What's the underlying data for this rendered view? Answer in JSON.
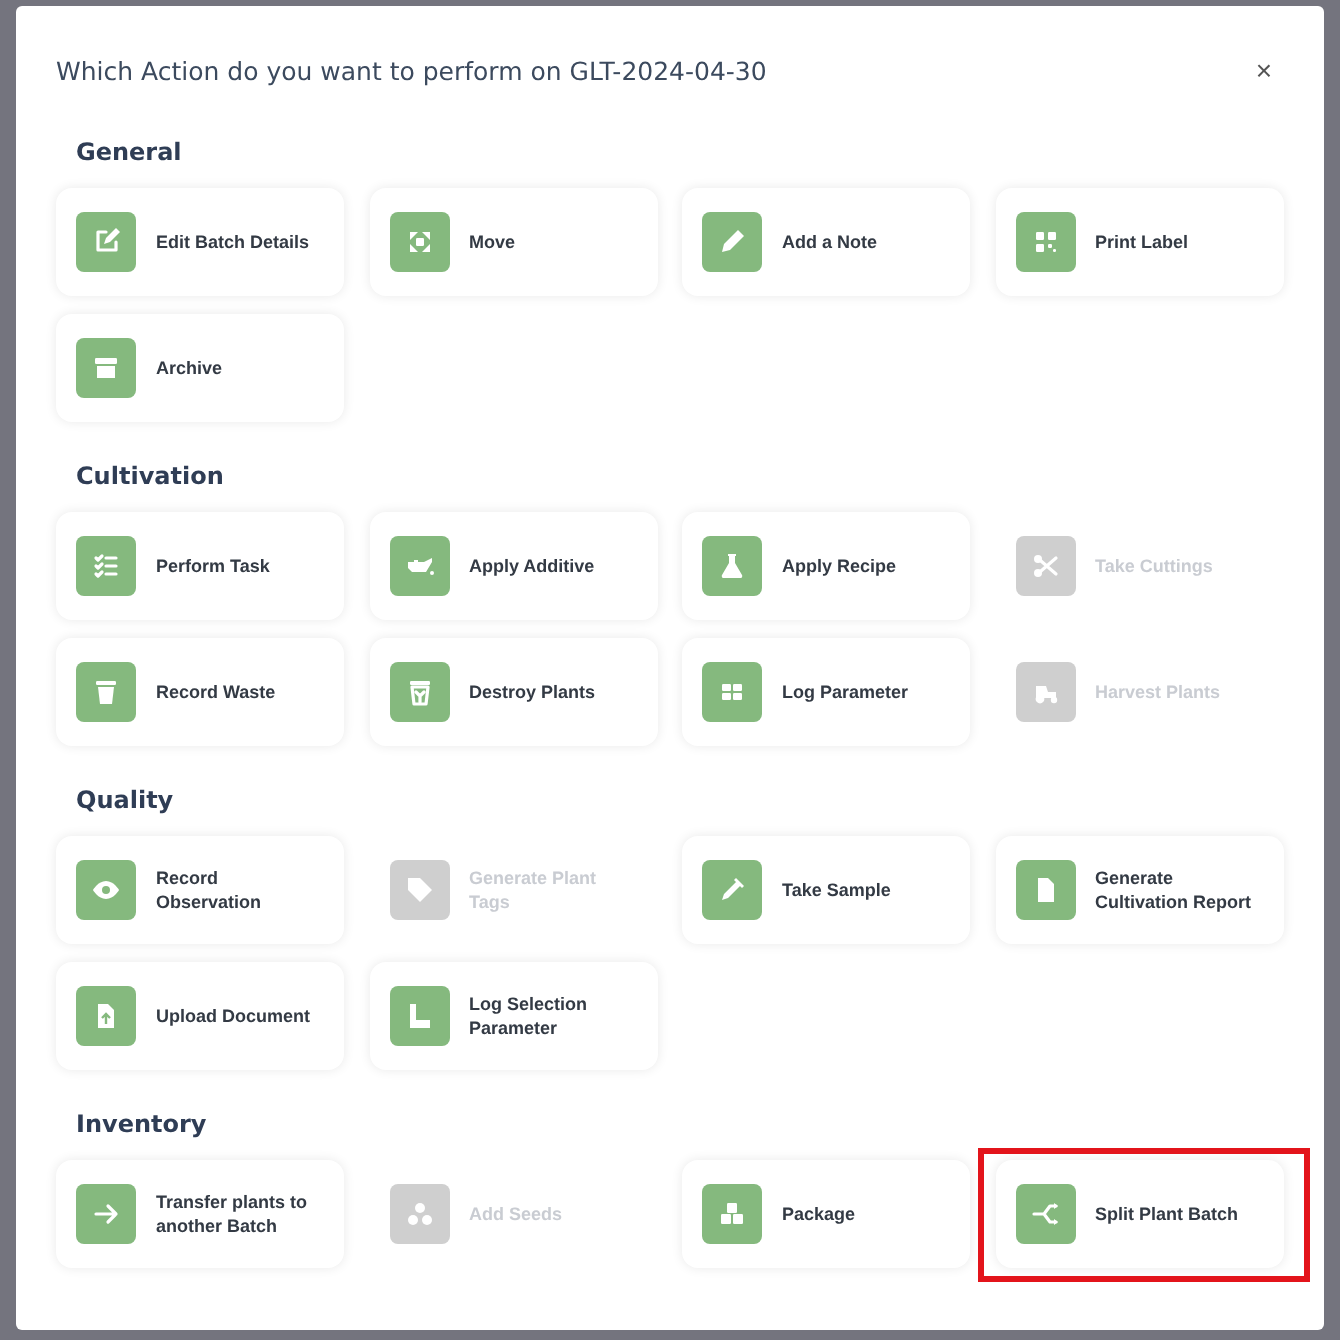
{
  "dialog": {
    "title": "Which Action do you want to perform on GLT-2024-04-30",
    "close": "×"
  },
  "sections": [
    {
      "title": "General",
      "items": [
        {
          "label": "Edit Batch Details",
          "disabled": false,
          "highlighted": false
        },
        {
          "label": "Move",
          "disabled": false,
          "highlighted": false
        },
        {
          "label": "Add a Note",
          "disabled": false,
          "highlighted": false
        },
        {
          "label": "Print Label",
          "disabled": false,
          "highlighted": false
        },
        {
          "label": "Archive",
          "disabled": false,
          "highlighted": false
        }
      ]
    },
    {
      "title": "Cultivation",
      "items": [
        {
          "label": "Perform Task",
          "disabled": false,
          "highlighted": false
        },
        {
          "label": "Apply Additive",
          "disabled": false,
          "highlighted": false
        },
        {
          "label": "Apply Recipe",
          "disabled": false,
          "highlighted": false
        },
        {
          "label": "Take Cuttings",
          "disabled": true,
          "highlighted": false
        },
        {
          "label": "Record Waste",
          "disabled": false,
          "highlighted": false
        },
        {
          "label": "Destroy Plants",
          "disabled": false,
          "highlighted": false
        },
        {
          "label": "Log Parameter",
          "disabled": false,
          "highlighted": false
        },
        {
          "label": "Harvest Plants",
          "disabled": true,
          "highlighted": false
        }
      ]
    },
    {
      "title": "Quality",
      "items": [
        {
          "label": "Record Observation",
          "disabled": false,
          "highlighted": false
        },
        {
          "label": "Generate Plant Tags",
          "disabled": true,
          "highlighted": false
        },
        {
          "label": "Take Sample",
          "disabled": false,
          "highlighted": false
        },
        {
          "label": "Generate Cultivation Report",
          "disabled": false,
          "highlighted": false
        },
        {
          "label": "Upload Document",
          "disabled": false,
          "highlighted": false
        },
        {
          "label": "Log Selection Parameter",
          "disabled": false,
          "highlighted": false
        }
      ]
    },
    {
      "title": "Inventory",
      "items": [
        {
          "label": "Transfer plants to another Batch",
          "disabled": false,
          "highlighted": false
        },
        {
          "label": "Add Seeds",
          "disabled": true,
          "highlighted": false
        },
        {
          "label": "Package",
          "disabled": false,
          "highlighted": false
        },
        {
          "label": "Split Plant Batch",
          "disabled": false,
          "highlighted": true
        }
      ]
    }
  ]
}
